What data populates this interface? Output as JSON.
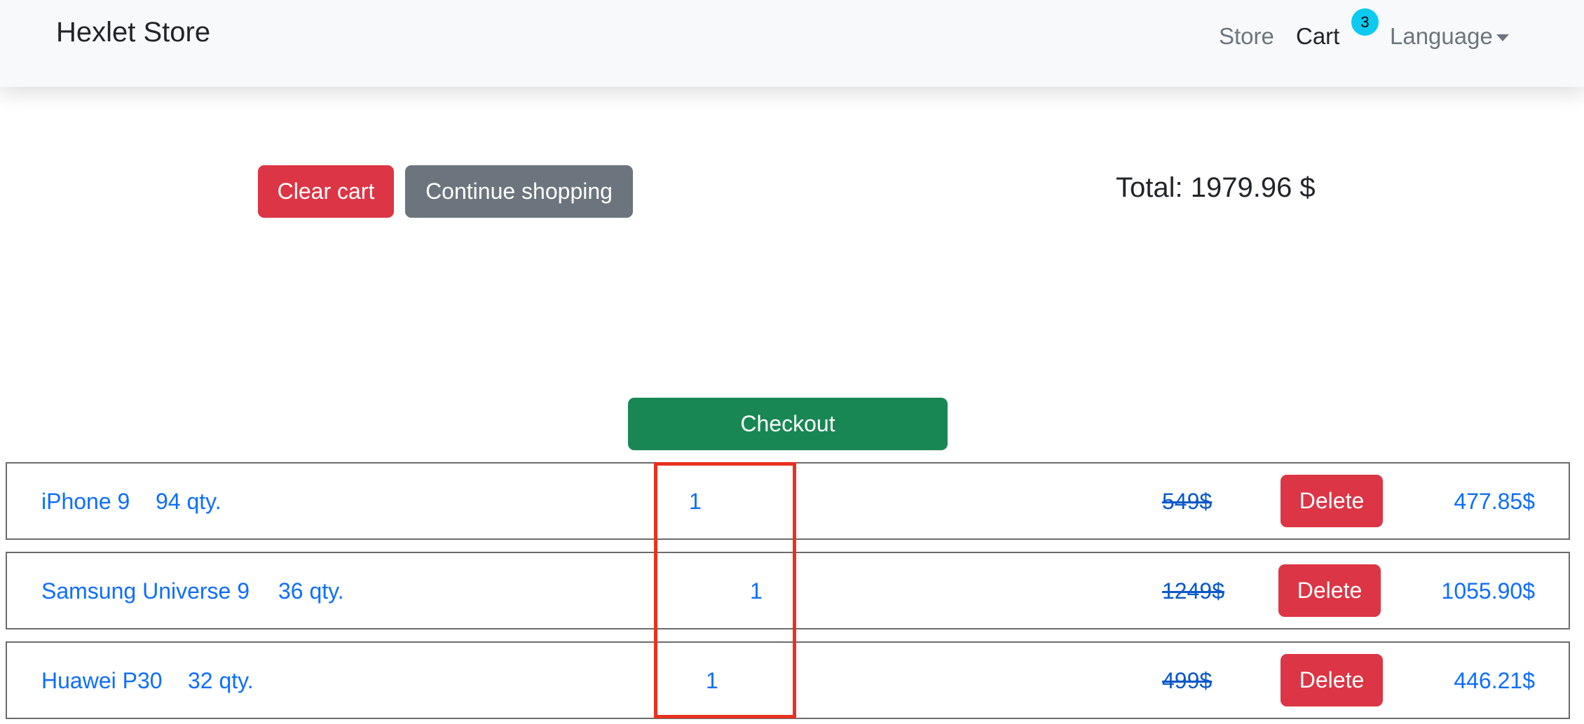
{
  "navbar": {
    "brand": "Hexlet Store",
    "links": {
      "store": "Store",
      "cart": "Cart",
      "language": "Language"
    },
    "cart_badge": "3"
  },
  "actions": {
    "clear_cart": "Clear cart",
    "continue_shopping": "Continue shopping",
    "checkout": "Checkout"
  },
  "total": "Total: 1979.96 $",
  "cart_items": [
    {
      "name": "iPhone 9",
      "stock": "94 qty.",
      "count": "1",
      "old_price": "549$",
      "delete": "Delete",
      "price": "477.85$"
    },
    {
      "name": "Samsung Universe 9",
      "stock": "36 qty.",
      "count": "1",
      "old_price": "1249$",
      "delete": "Delete",
      "price": "1055.90$"
    },
    {
      "name": "Huawei P30",
      "stock": "32 qty.",
      "count": "1",
      "old_price": "499$",
      "delete": "Delete",
      "price": "446.21$"
    }
  ],
  "colors": {
    "danger": "#dc3545",
    "secondary": "#6c757d",
    "success": "#198754",
    "link": "#0d6efd",
    "badge": "#0dcaf0",
    "highlight": "#e8321f"
  }
}
